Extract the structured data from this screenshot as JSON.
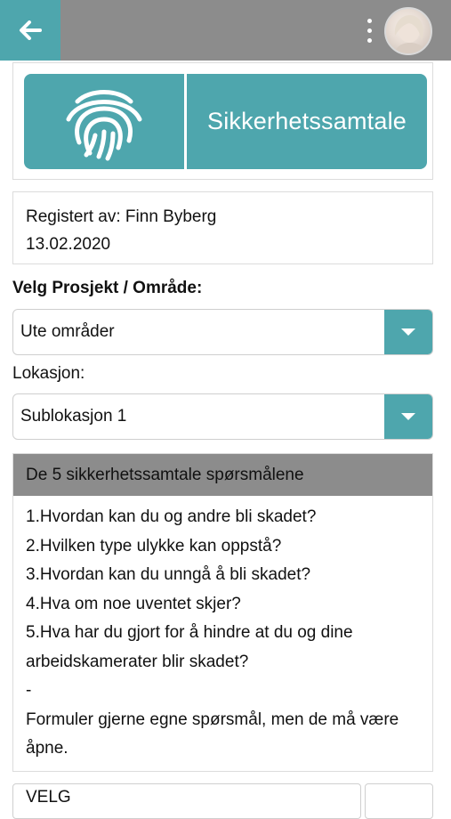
{
  "header": {
    "back_icon": "arrow-left-icon",
    "menu_icon": "vertical-dots-icon",
    "avatar": "user-avatar"
  },
  "banner": {
    "icon": "fingerprint-icon",
    "title": "Sikkerhetssamtale",
    "color": "#4ea6ad"
  },
  "registration": {
    "registered_by": "Registert av: Finn Byberg",
    "date": "13.02.2020"
  },
  "project": {
    "label": "Velg Prosjekt / Område:",
    "value": "Ute områder"
  },
  "location": {
    "label": "Lokasjon:",
    "value": "Sublokasjon 1"
  },
  "questions": {
    "title": "De 5 sikkerhetssamtale spørsmålene",
    "items": [
      "1.Hvordan kan du og andre bli skadet?",
      "2.Hvilken type ulykke kan oppstå?",
      "3.Hvordan kan du unngå å bli skadet?",
      "4.Hva om noe uventet skjer?",
      "5.Hva har du gjort for å hindre at du og dine arbeidskamerater blir skadet?"
    ],
    "separator": "-",
    "note": "Formuler gjerne egne spørsmål, men de må være åpne."
  },
  "bottom_select": {
    "value": "VELG"
  }
}
